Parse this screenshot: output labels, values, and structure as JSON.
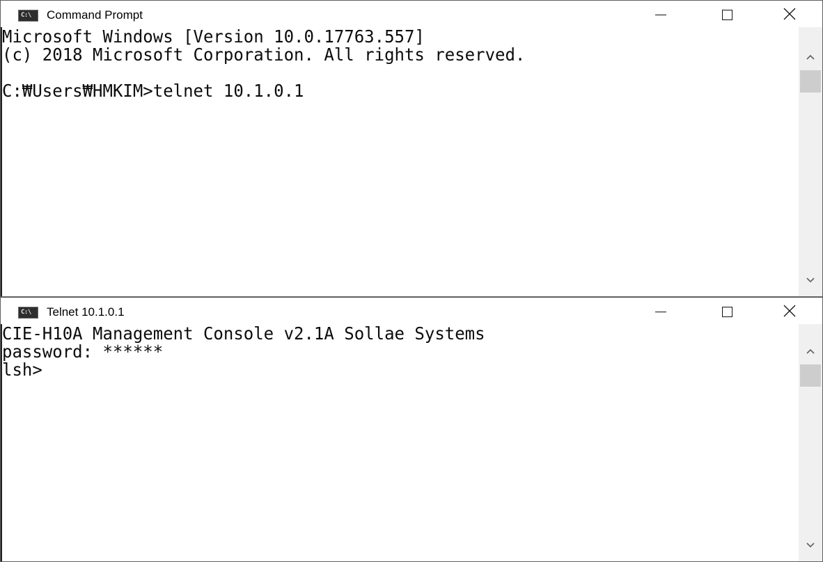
{
  "windows": [
    {
      "title": "Command Prompt",
      "icon_text": "C:\\",
      "icons": {
        "min": "minimize-icon",
        "max": "maximize-icon",
        "close": "close-icon"
      },
      "lines": [
        "Microsoft Windows [Version 10.0.17763.557]",
        "(c) 2018 Microsoft Corporation. All rights reserved.",
        "",
        "C:₩Users₩HMKIM>telnet 10.1.0.1"
      ]
    },
    {
      "title": "Telnet 10.1.0.1",
      "icon_text": "C:\\",
      "icons": {
        "min": "minimize-icon",
        "max": "maximize-icon",
        "close": "close-icon"
      },
      "lines": [
        "CIE-H10A Management Console v2.1A Sollae Systems",
        "password: ******",
        "lsh>"
      ]
    }
  ],
  "colors": {
    "console_bg": "#ffffff",
    "console_text": "#0c0c0c",
    "scrollbar_track": "#f0f0f0",
    "scrollbar_thumb": "#cdcdcd"
  }
}
